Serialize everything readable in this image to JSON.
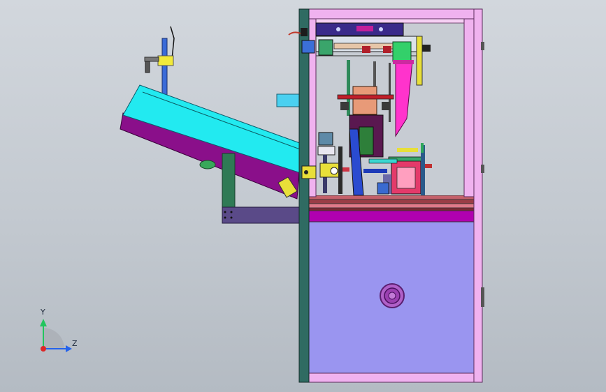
{
  "viewport": {
    "background_top": "#d2d7dd",
    "background_bottom": "#b4bbc3"
  },
  "triad": {
    "y_label": "Y",
    "z_label": "Z",
    "y_color": "#22c55e",
    "z_color": "#2563eb",
    "x_color": "#dc2626"
  },
  "colors": {
    "frame_pink": "#f0b2ef",
    "frame_outline": "#5a2a5a",
    "left_plate": "#2f6b62",
    "lower_panel": "#9a95f0",
    "magenta_band": "#b000b0",
    "chute_top": "#22eaf0",
    "chute_bottom": "#8a0f8a",
    "stand_green": "#2f7a55",
    "crossbar": "#5a4a88",
    "hopper": "#ff33cc",
    "block_salmon": "#e89a78",
    "gear_purple": "#8a3aa8"
  }
}
